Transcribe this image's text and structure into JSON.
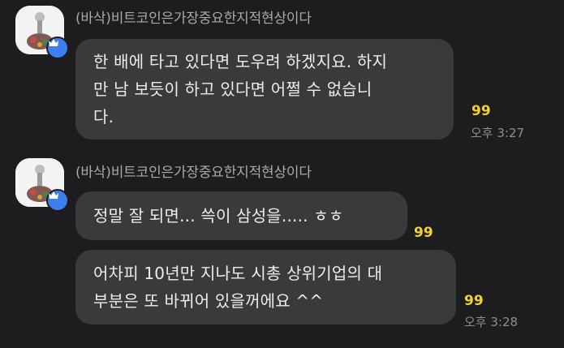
{
  "messages": [
    {
      "sender": "(바삭)비트코인은가장중요한지적현상이다",
      "bubbles": [
        {
          "lines": [
            "한 배에 타고 있다면 도우려 하겠지요. 하지",
            "만 남 보듯이 하고 있다면 어쩔 수 없습니",
            "다."
          ],
          "unread": "99",
          "time": "오후 3:27"
        }
      ]
    },
    {
      "sender": "(바삭)비트코인은가장중요한지적현상이다",
      "bubbles": [
        {
          "lines": [
            "정말 잘 되면... 쓱이 삼성을..... ㅎㅎ"
          ],
          "unread": "99",
          "time": ""
        },
        {
          "lines": [
            "어차피 10년만 지나도 시총 상위기업의 대",
            "부분은 또 바뀌어 있을꺼에요 ^^"
          ],
          "unread": "99",
          "time": "오후 3:28"
        }
      ]
    }
  ],
  "colors": {
    "background": "#1d1d1f",
    "bubble": "#3a3a3c",
    "unread": "#f2d22e",
    "badge": "#3d7ff0"
  },
  "icons": {
    "avatar_badge": "crown-icon",
    "avatar": "profile-photo"
  }
}
